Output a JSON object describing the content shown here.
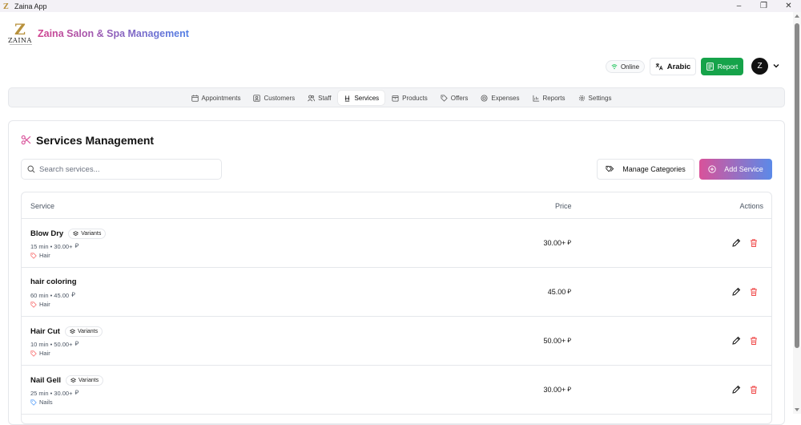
{
  "window": {
    "title": "Zaina App"
  },
  "brand": {
    "logo_text": "ZAINA",
    "name": "Zaina Salon & Spa Management"
  },
  "header": {
    "status_label": "Online",
    "language_label": "Arabic",
    "report_label": "Report",
    "avatar_initial": "Z"
  },
  "nav": {
    "tabs": [
      {
        "label": "Appointments",
        "icon": "calendar-icon"
      },
      {
        "label": "Customers",
        "icon": "contact-card-icon"
      },
      {
        "label": "Staff",
        "icon": "users-icon"
      },
      {
        "label": "Services",
        "icon": "salon-chair-icon",
        "active": true
      },
      {
        "label": "Products",
        "icon": "package-icon"
      },
      {
        "label": "Offers",
        "icon": "tag-icon"
      },
      {
        "label": "Expenses",
        "icon": "coins-icon"
      },
      {
        "label": "Reports",
        "icon": "bar-chart-icon"
      },
      {
        "label": "Settings",
        "icon": "gear-icon"
      }
    ]
  },
  "services": {
    "title": "Services Management",
    "search_placeholder": "Search services...",
    "manage_categories_label": "Manage Categories",
    "add_service_label": "Add Service",
    "columns": {
      "service": "Service",
      "price": "Price",
      "actions": "Actions"
    },
    "rows": [
      {
        "name": "Blow Dry",
        "variants": "Variants",
        "meta": "15 min • 30.00+",
        "category": "Hair",
        "price": "30.00+"
      },
      {
        "name": "hair coloring",
        "variants": "",
        "meta": "60 min • 45.00",
        "category": "Hair",
        "price": "45.00"
      },
      {
        "name": "Hair Cut",
        "variants": "Variants",
        "meta": "10 min • 50.00+",
        "category": "Hair",
        "price": "50.00+"
      },
      {
        "name": "Nail Gell",
        "variants": "Variants",
        "meta": "25 min • 30.00+",
        "category": "Nails",
        "price": "30.00+"
      }
    ]
  },
  "colors": {
    "accent_pink": "#d9529a",
    "accent_blue": "#5b8ae8",
    "report_green": "#16a34a",
    "hair_tag": "#f87171",
    "nails_tag": "#60a5fa",
    "delete_red": "#ef4444"
  }
}
